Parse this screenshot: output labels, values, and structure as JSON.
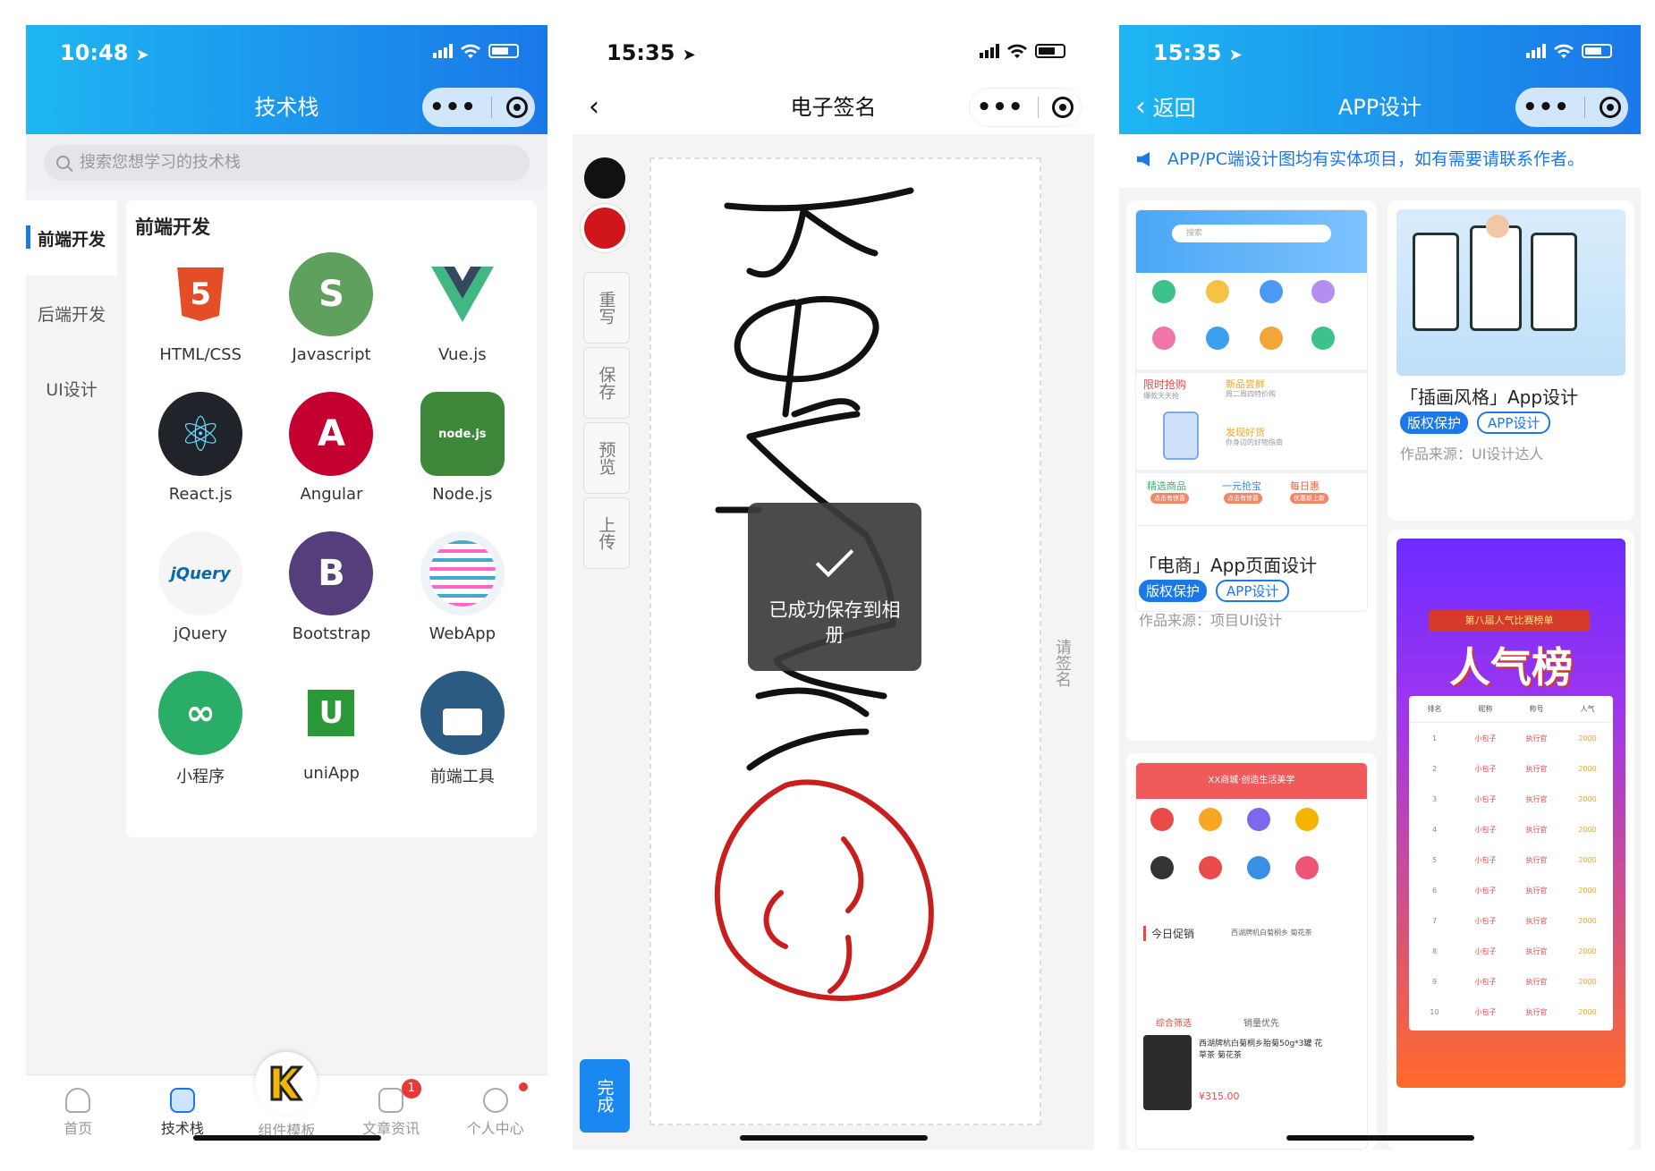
{
  "phone1": {
    "status_time": "10:48",
    "nav_title": "技术栈",
    "search_placeholder": "搜索您想学习的技术栈",
    "side_menu": [
      "前端开发",
      "后端开发",
      "UI设计"
    ],
    "panel_title": "前端开发",
    "techs": [
      {
        "label": "HTML/CSS",
        "icon": "html5-icon",
        "color": "#e44d26",
        "text": "5"
      },
      {
        "label": "Javascript",
        "icon": "javascript-icon",
        "color": "#5fa05f",
        "text": "S"
      },
      {
        "label": "Vue.js",
        "icon": "vue-icon",
        "color": "#ffffff",
        "text": ""
      },
      {
        "label": "React.js",
        "icon": "react-icon",
        "color": "#20232a",
        "text": "⚛"
      },
      {
        "label": "Angular",
        "icon": "angular-icon",
        "color": "#c3002f",
        "text": "A"
      },
      {
        "label": "Node.js",
        "icon": "nodejs-icon",
        "color": "#3c873a",
        "text": "node.js"
      },
      {
        "label": "jQuery",
        "icon": "jquery-icon",
        "color": "#f5f5f5",
        "text": "jQuery"
      },
      {
        "label": "Bootstrap",
        "icon": "bootstrap-icon",
        "color": "#563d7c",
        "text": "B"
      },
      {
        "label": "WebApp",
        "icon": "webapp-icon",
        "color": "#eef3f7",
        "text": ""
      },
      {
        "label": "小程序",
        "icon": "miniprogram-icon",
        "color": "#2aae67",
        "text": "∞"
      },
      {
        "label": "uniApp",
        "icon": "uniapp-icon",
        "color": "#ffffff",
        "text": "U"
      },
      {
        "label": "前端工具",
        "icon": "frontend-tools-icon",
        "color": "#2b5a82",
        "text": ""
      }
    ],
    "tabs": [
      {
        "label": "首页",
        "icon": "home-icon"
      },
      {
        "label": "技术栈",
        "icon": "stack-icon"
      },
      {
        "label": "组件模板",
        "icon": "component-icon"
      },
      {
        "label": "文章资讯",
        "icon": "article-icon",
        "badge": "1"
      },
      {
        "label": "个人中心",
        "icon": "user-icon"
      }
    ]
  },
  "phone2": {
    "status_time": "15:35",
    "nav_title": "电子签名",
    "colors": [
      "#111111",
      "#d0161b"
    ],
    "tools": [
      "重写",
      "保存",
      "预览",
      "上传"
    ],
    "done_label": "完成",
    "hint": "请签名",
    "toast": "已成功保存到相册"
  },
  "phone3": {
    "status_time": "15:35",
    "back_label": "返回",
    "nav_title": "APP设计",
    "notice": "APP/PC端设计图均有实体项目，如有需要请联系作者。",
    "cards": [
      {
        "title": "「电商」App页面设计",
        "tag1": "版权保护",
        "tag2": "APP设计",
        "source": "作品来源：项目UI设计"
      },
      {
        "title": "「插画风格」App设计",
        "tag1": "版权保护",
        "tag2": "APP设计",
        "source": "作品来源：UI设计达人"
      }
    ],
    "ecommerce_sections": {
      "flash": "限时抢购",
      "flash_sub": "爆款天天抢",
      "new": "新品尝鲜",
      "new_sub": "周二周四特价购",
      "discover": "发现好货",
      "discover_sub": "你身边的好物指南",
      "pick": "精选商品",
      "pick_sub": "点击有惊喜",
      "one": "一元抢宝",
      "one_sub": "点击有惊喜",
      "daily": "每日惠",
      "daily_sub": "优惠新上新",
      "search": "搜索"
    },
    "shop_title": "XX商城·创造生活美学",
    "shop_promo": "今日促销",
    "shop_promo_right": "西湖牌机白菊桐乡 菊花茶",
    "shop_sort": [
      "综合筛选",
      "销量优先"
    ],
    "shop_product": "西湖牌杭白菊桐乡胎菊50g*3罐 花草茶 菊花茶",
    "shop_price": "¥315.00",
    "rank_title": "第八届人气比赛榜单",
    "rank_big": "人气榜",
    "rank_headers": [
      "排名",
      "昵称",
      "称号",
      "人气"
    ],
    "rank_rows": [
      [
        "1",
        "小包子",
        "执行官",
        "2000"
      ],
      [
        "2",
        "小包子",
        "执行官",
        "2000"
      ],
      [
        "3",
        "小包子",
        "执行官",
        "2000"
      ],
      [
        "4",
        "小包子",
        "执行官",
        "2000"
      ],
      [
        "5",
        "小包子",
        "执行官",
        "2000"
      ],
      [
        "6",
        "小包子",
        "执行官",
        "2000"
      ],
      [
        "7",
        "小包子",
        "执行官",
        "2000"
      ],
      [
        "8",
        "小包子",
        "执行官",
        "2000"
      ],
      [
        "9",
        "小包子",
        "执行官",
        "2000"
      ],
      [
        "10",
        "小包子",
        "执行官",
        "2000"
      ]
    ]
  }
}
